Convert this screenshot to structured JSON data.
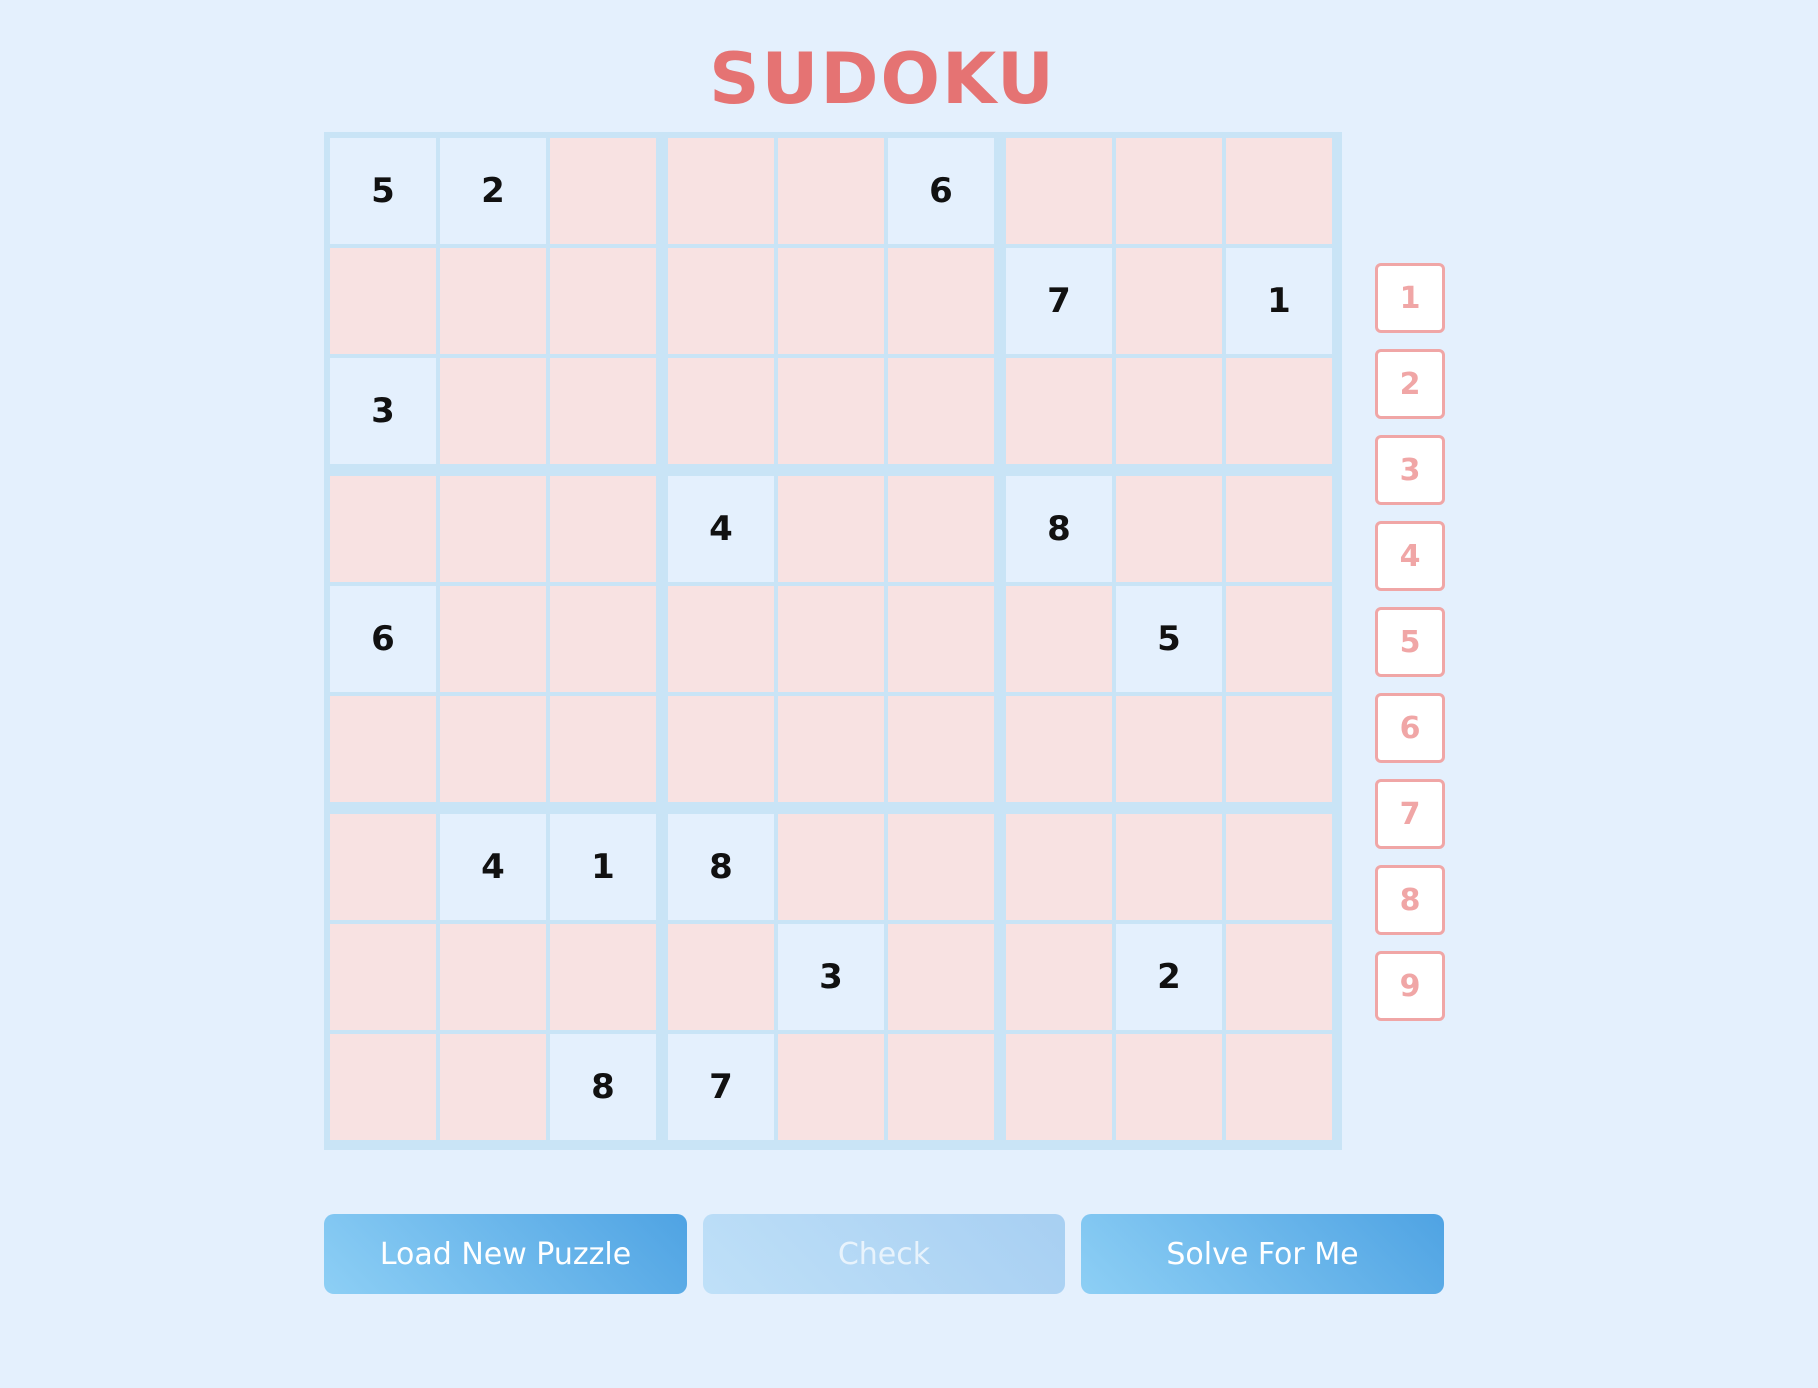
{
  "title": "SUDOKU",
  "board": {
    "cells": [
      [
        "5",
        "2",
        "",
        "",
        "",
        "6",
        "",
        "",
        ""
      ],
      [
        "",
        "",
        "",
        "",
        "",
        "",
        "7",
        "",
        "1"
      ],
      [
        "3",
        "",
        "",
        "",
        "",
        "",
        "",
        "",
        ""
      ],
      [
        "",
        "",
        "",
        "4",
        "",
        "",
        "8",
        "",
        ""
      ],
      [
        "6",
        "",
        "",
        "",
        "",
        "",
        "",
        "5",
        ""
      ],
      [
        "",
        "",
        "",
        "",
        "",
        "",
        "",
        "",
        ""
      ],
      [
        "",
        "4",
        "1",
        "8",
        "",
        "",
        "",
        "",
        ""
      ],
      [
        "",
        "",
        "",
        "",
        "3",
        "",
        "",
        "2",
        ""
      ],
      [
        "",
        "",
        "8",
        "7",
        "",
        "",
        "",
        "",
        ""
      ]
    ]
  },
  "number_pad": [
    "1",
    "2",
    "3",
    "4",
    "5",
    "6",
    "7",
    "8",
    "9"
  ],
  "buttons": {
    "load": "Load New Puzzle",
    "check": "Check",
    "solve": "Solve For Me"
  },
  "colors": {
    "background": "#e4f0fd",
    "title": "#e57373",
    "empty_cell": "#f8e2e2",
    "given_cell": "#e4f0fd",
    "grid_lines": "#c9e4f6",
    "number_pad": "#f0a6a6",
    "button_gradient_start": "#8dcff5",
    "button_gradient_end": "#4fa3e3"
  }
}
